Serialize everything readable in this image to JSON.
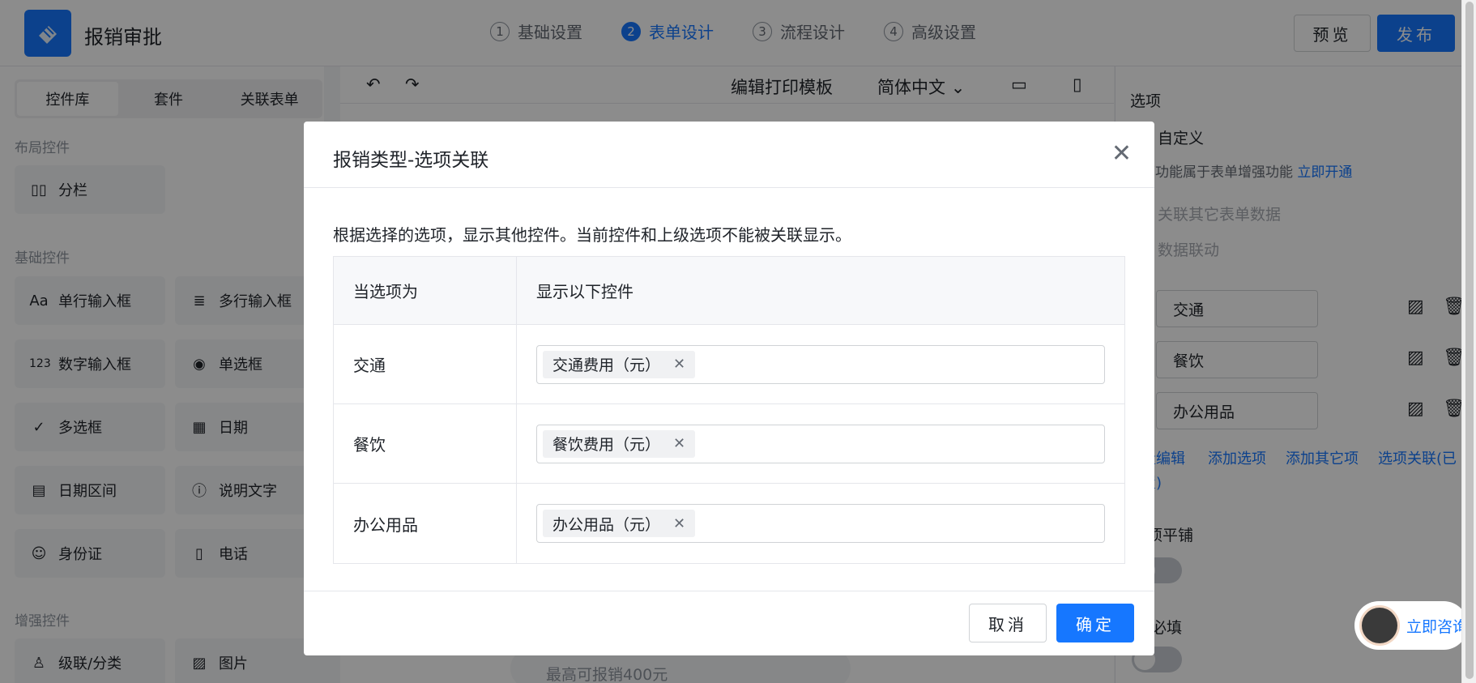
{
  "header": {
    "app_title": "报销审批",
    "steps": [
      {
        "num": "1",
        "label": "基础设置"
      },
      {
        "num": "2",
        "label": "表单设计"
      },
      {
        "num": "3",
        "label": "流程设计"
      },
      {
        "num": "4",
        "label": "高级设置"
      }
    ],
    "preview_label": "预览",
    "publish_label": "发布"
  },
  "left": {
    "tabs": [
      "控件库",
      "套件",
      "关联表单"
    ],
    "layout_title": "布局控件",
    "layout_items": [
      {
        "label": "分栏",
        "icon": "columns-icon"
      }
    ],
    "basic_title": "基础控件",
    "basic_items": [
      {
        "label": "单行输入框",
        "icon": "text-input-icon",
        "glyph": "Aa"
      },
      {
        "label": "多行输入框",
        "icon": "textarea-icon",
        "glyph": "≣"
      },
      {
        "label": "数字输入框",
        "icon": "number-input-icon",
        "glyph": "123"
      },
      {
        "label": "单选框",
        "icon": "radio-icon",
        "glyph": "◉"
      },
      {
        "label": "多选框",
        "icon": "checkbox-icon",
        "glyph": "✓"
      },
      {
        "label": "日期",
        "icon": "calendar-icon",
        "glyph": "▦"
      },
      {
        "label": "日期区间",
        "icon": "date-range-icon",
        "glyph": "▤"
      },
      {
        "label": "说明文字",
        "icon": "info-icon",
        "glyph": "ⓘ"
      },
      {
        "label": "身份证",
        "icon": "id-card-icon",
        "glyph": "☺"
      },
      {
        "label": "电话",
        "icon": "phone-icon",
        "glyph": "▯"
      }
    ],
    "enhanced_title": "增强控件",
    "enhanced_items": [
      {
        "label": "级联/分类",
        "icon": "cascade-icon",
        "glyph": "♙"
      },
      {
        "label": "图片",
        "icon": "image-icon",
        "glyph": "▨"
      }
    ]
  },
  "center": {
    "print_template": "编辑打印模板",
    "language": "简体中文",
    "bottom_hint": "最高可报销400元"
  },
  "right": {
    "section_title": "选项",
    "custom_label": "自定义",
    "enhance_note": "下功能属于表单增强功能",
    "enable_link": "立即开通",
    "link_other_form": "关联其它表单数据",
    "data_linkage": "数据联动",
    "options": [
      "交通",
      "餐饮",
      "办公用品"
    ],
    "actions": [
      "批量编辑",
      "添加选项",
      "添加其它项",
      "选项关联(已",
      "设置)"
    ],
    "tile_label": "选项平铺",
    "required_label": "必填"
  },
  "modal": {
    "title": "报销类型-选项关联",
    "description": "根据选择的选项，显示其他控件。当前控件和上级选项不能被关联显示。",
    "col1_header": "当选项为",
    "col2_header": "显示以下控件",
    "rows": [
      {
        "option": "交通",
        "control": "交通费用（元）"
      },
      {
        "option": "餐饮",
        "control": "餐饮费用（元）"
      },
      {
        "option": "办公用品",
        "control": "办公用品（元）"
      }
    ],
    "cancel_label": "取消",
    "ok_label": "确定"
  },
  "consult": {
    "label": "立即咨询"
  },
  "colors": {
    "accent": "#1677ff"
  }
}
